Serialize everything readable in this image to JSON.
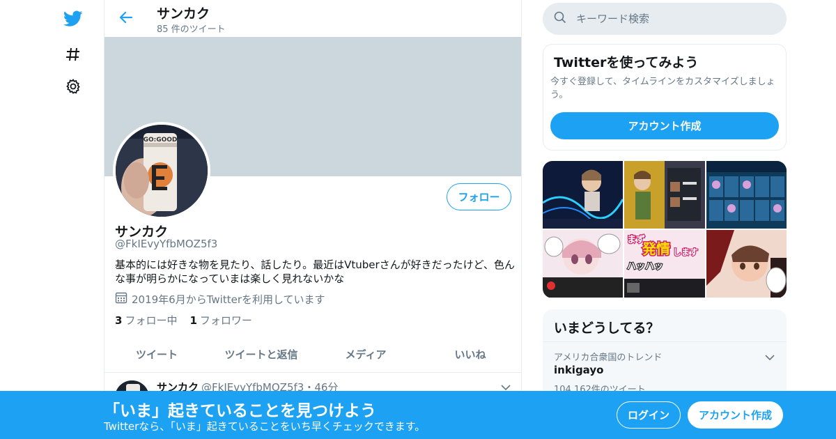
{
  "colors": {
    "accent": "#1da1f2",
    "banner": "#ccd6dd",
    "secondary_text": "#657786"
  },
  "nav": {
    "icons": [
      "twitter-logo-icon",
      "hashtag-icon",
      "gear-icon"
    ]
  },
  "header": {
    "title": "サンカク",
    "tweet_count": "85 件のツイート"
  },
  "profile": {
    "follow_label": "フォロー",
    "display_name": "サンカク",
    "handle": "@FkIEvyYfbMOZ5f3",
    "bio": "基本的には好きな物を見たり、話したり。最近はVtuberさんが好きだったけど、色んな事が明らかになっていまは楽しく見れないかな",
    "joined": "2019年6月からTwitterを利用しています",
    "following_count": "3",
    "following_label": "フォロー中",
    "followers_count": "1",
    "followers_label": "フォロワー"
  },
  "tabs": [
    {
      "label": "ツイート"
    },
    {
      "label": "ツイートと返信"
    },
    {
      "label": "メディア"
    },
    {
      "label": "いいね"
    }
  ],
  "tweet": {
    "name": "サンカク",
    "meta": "@FkIEvyYfbMOZ5f3・46分"
  },
  "search": {
    "placeholder": "キーワード検索"
  },
  "signup_card": {
    "title": "Twitterを使ってみよう",
    "description": "今すぐ登録して、タイムラインをカスタマイズしましょう。",
    "button": "アカウント作成"
  },
  "media": {
    "thumb_texts": {
      "t5_a": "まず",
      "t5_b": "発情",
      "t5_c": "します",
      "t5_d": "ハッハッ"
    }
  },
  "trends": {
    "title": "いまどうしてる？",
    "items": [
      {
        "location": "アメリカ合衆国のトレンド",
        "name": "inkigayo",
        "count": "104,162件のツイート"
      }
    ]
  },
  "bottom_bar": {
    "title": "「いま」起きていることを見つけよう",
    "subtitle": "Twitterなら、「いま」起きていることをいち早くチェックできます。",
    "login": "ログイン",
    "signup": "アカウント作成"
  }
}
